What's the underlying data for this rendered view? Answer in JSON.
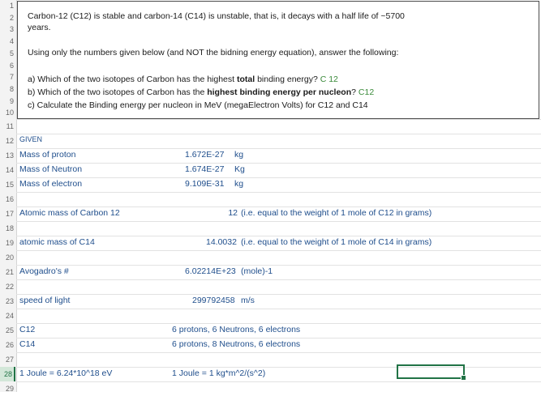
{
  "row_numbers": [
    "1",
    "2",
    "3",
    "4",
    "5",
    "6",
    "7",
    "8",
    "9",
    "10",
    "11",
    "12",
    "13",
    "14",
    "15",
    "16",
    "17",
    "18",
    "19",
    "20",
    "21",
    "22",
    "23",
    "24",
    "25",
    "26",
    "27",
    "28",
    "29"
  ],
  "textbox": {
    "line1": "Carbon-12 (C12) is stable and carbon-14 (C14) is unstable, that is, it decays with a half life of ~5700",
    "line2": "years.",
    "line3": "Using only the numbers given below (and NOT the bidning energy equation), answer the following:",
    "q_a_pre": "a) Which of the two isotopes of Carbon has the highest ",
    "q_a_bold": "total",
    "q_a_post": " binding energy? ",
    "q_a_answer": "C 12",
    "q_b_pre": "b) Which of the two isotopes of Carbon has the ",
    "q_b_bold": "highest binding energy per nucleon",
    "q_b_post": "? ",
    "q_b_answer": "C12",
    "q_c": "c) Calculate the Binding energy per nucleon in MeV (megaElectron Volts) for C12 and C14"
  },
  "cells": {
    "r12_a": "GIVEN",
    "r13_a": "Mass of proton",
    "r13_b": "1.672E-27",
    "r13_c": "kg",
    "r14_a": "Mass of Neutron",
    "r14_b": "1.674E-27",
    "r14_c": "Kg",
    "r15_a": "Mass of electron",
    "r15_b": "9.109E-31",
    "r15_c": "kg",
    "r17_a": "Atomic mass of Carbon 12",
    "r17_b": "12",
    "r17_c": "(i.e. equal to the weight of 1 mole of C12 in grams)",
    "r19_a": "atomic mass of C14",
    "r19_b": "14.0032",
    "r19_c": "(i.e. equal  to the weight of 1 mole of C14 in grams)",
    "r21_a": "Avogadro's #",
    "r21_b": "6.02214E+23",
    "r21_c": "(mole)-1",
    "r23_a": "speed of light",
    "r23_b": "299792458",
    "r23_c": "m/s",
    "r25_a": "C12",
    "r25_b": "6 protons, 6 Neutrons, 6 electrons",
    "r26_a": "C14",
    "r26_b": "6 protons, 8 Neutrons, 6 electrons",
    "r28_a": "1 Joule = 6.24*10^18 eV",
    "r28_b": "1 Joule = 1 kg*m^2/(s^2)"
  },
  "colors": {
    "text_blue": "#1f4e8c",
    "answer_green": "#3a8a3a",
    "selection": "#217346"
  }
}
